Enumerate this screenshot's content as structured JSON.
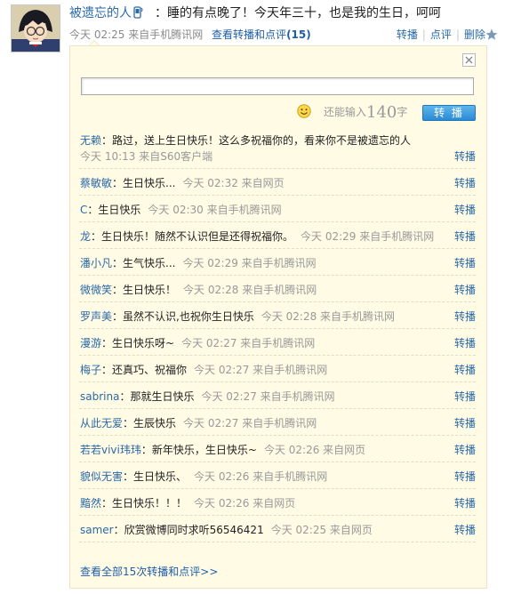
{
  "post": {
    "author": "被遗忘的人",
    "text": "：睡的有点晚了！今天年三十，也是我的生日，呵呵",
    "meta": "今天 02:25 来自手机腾讯网",
    "view_link_prefix": "查看转播和点评",
    "view_count": "(15)",
    "actions": [
      "转播",
      "点评",
      "删除"
    ]
  },
  "repost_box": {
    "input_value": "",
    "remaining_prefix": "还能输入",
    "remaining_count": "140",
    "remaining_suffix": "字",
    "submit_label": "转 播"
  },
  "reposts": [
    {
      "name": "无赖",
      "msg": "：路过，送上生日快乐！这么多祝福你的，看来你不是被遗忘的人",
      "time": "今天 10:13 来自S60客户端",
      "action": "转播"
    },
    {
      "name": "蔡敏敏",
      "msg": "：生日快乐...",
      "time": "今天 02:32 来自网页",
      "action": "转播"
    },
    {
      "name": "C",
      "msg": "：生日快乐",
      "time": "今天 02:30 来自手机腾讯网",
      "action": "转播"
    },
    {
      "name": "龙",
      "msg": "：生日快乐！随然不认识但是还得祝福你。",
      "time": "今天 02:29 来自手机腾讯网",
      "action": "转播"
    },
    {
      "name": "潘小凡",
      "msg": "：生气快乐...",
      "time": "今天 02:29 来自手机腾讯网",
      "action": "转播"
    },
    {
      "name": "微微笑",
      "msg": "：生日快乐！",
      "time": "今天 02:28 来自手机腾讯网",
      "action": "转播"
    },
    {
      "name": "罗声美",
      "msg": "：虽然不认识,也祝你生日快乐",
      "time": "今天 02:28 来自手机腾讯网",
      "action": "转播"
    },
    {
      "name": "漫游",
      "msg": "：生日快乐呀~",
      "time": "今天 02:27 来自手机腾讯网",
      "action": "转播"
    },
    {
      "name": "梅子",
      "msg": "：还真巧、祝福你",
      "time": "今天 02:27 来自手机腾讯网",
      "action": "转播"
    },
    {
      "name": "sabrina",
      "msg": "：那就生日快乐",
      "time": "今天 02:27 来自手机腾讯网",
      "action": "转播"
    },
    {
      "name": "从此无爱",
      "msg": "：生辰快乐",
      "time": "今天 02:27 来自手机腾讯网",
      "action": "转播"
    },
    {
      "name": "若若vivi玮玮",
      "msg": "：新年快乐，生日快乐~",
      "time": "今天 02:26 来自网页",
      "action": "转播"
    },
    {
      "name": "貌似无害",
      "msg": "：生日快乐、",
      "time": "今天 02:26 来自手机腾讯网",
      "action": "转播"
    },
    {
      "name": "黯然",
      "msg": "：生日快乐！！！",
      "time": "今天 02:26 来自网页",
      "action": "转播"
    },
    {
      "name": "samer",
      "msg": "：欣赏微博同时求听56546421",
      "time": "今天 02:25 来自网页",
      "action": "转播"
    }
  ],
  "view_all": "查看全部15次转播和点评>>",
  "colors": {
    "link": "#2a6aa8",
    "panel_bg": "#fffbe5",
    "button": "#2a8ad4"
  },
  "icons": [
    "avatar",
    "mobile-phone-icon",
    "star-icon",
    "close-icon",
    "smiley-icon"
  ]
}
